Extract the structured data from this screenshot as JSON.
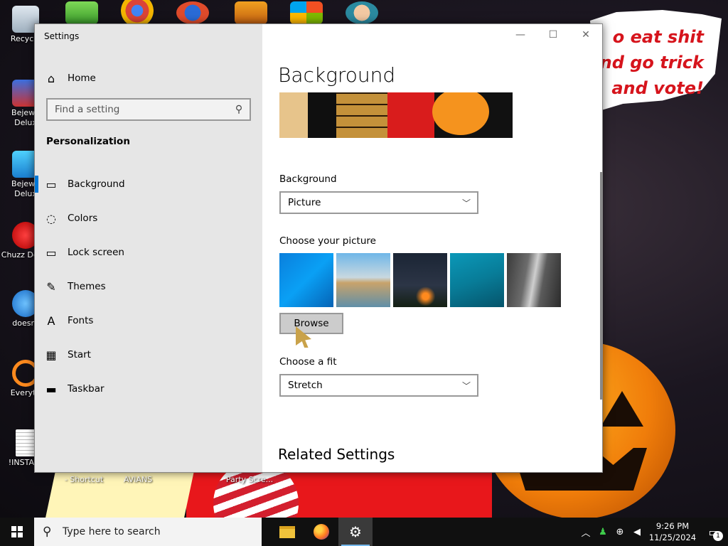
{
  "window": {
    "title": "Settings",
    "minimize_glyph": "—",
    "maximize_glyph": "☐",
    "close_glyph": "✕"
  },
  "sidebar": {
    "home_label": "Home",
    "home_icon": "home-icon",
    "search_placeholder": "Find a setting",
    "section_title": "Personalization",
    "items": [
      {
        "label": "Background",
        "icon": "background-picture-icon",
        "selected": true
      },
      {
        "label": "Colors",
        "icon": "palette-icon",
        "selected": false
      },
      {
        "label": "Lock screen",
        "icon": "lock-screen-icon",
        "selected": false
      },
      {
        "label": "Themes",
        "icon": "themes-brush-icon",
        "selected": false
      },
      {
        "label": "Fonts",
        "icon": "fonts-icon",
        "selected": false
      },
      {
        "label": "Start",
        "icon": "start-grid-icon",
        "selected": false
      },
      {
        "label": "Taskbar",
        "icon": "taskbar-icon",
        "selected": false
      }
    ]
  },
  "main": {
    "page_title": "Background",
    "background_label": "Background",
    "background_value": "Picture",
    "choose_picture_label": "Choose your picture",
    "browse_label": "Browse",
    "choose_fit_label": "Choose a fit",
    "fit_value": "Stretch",
    "related_settings": "Related Settings"
  },
  "desktop": {
    "speech_line1": "o eat shit",
    "speech_line2": "nd go trick",
    "speech_line3": "and vote!",
    "icons": [
      {
        "label": "Recycle",
        "icon": "recycle-bin-icon"
      },
      {
        "label": "Bejewe Delux",
        "icon": "bejeweled-icon"
      },
      {
        "label": "Bejewe Delux",
        "icon": "bejeweled-diamond-icon"
      },
      {
        "label": "Chuzz Delux",
        "icon": "chuzzle-icon"
      },
      {
        "label": "doesnt",
        "icon": "bird-icon"
      },
      {
        "label": "Everyth",
        "icon": "everything-search-icon"
      },
      {
        "label": "!INSTALL",
        "icon": "text-file-icon"
      }
    ],
    "bottom_labels": [
      "- Shortcut",
      "AVIANS",
      "Party Scre..."
    ]
  },
  "taskbar": {
    "search_placeholder": "Type here to search",
    "time": "9:26 PM",
    "date": "11/25/2024",
    "notification_count": "1",
    "colors": {
      "bar": "#101010",
      "accent": "#76b9ed"
    }
  }
}
